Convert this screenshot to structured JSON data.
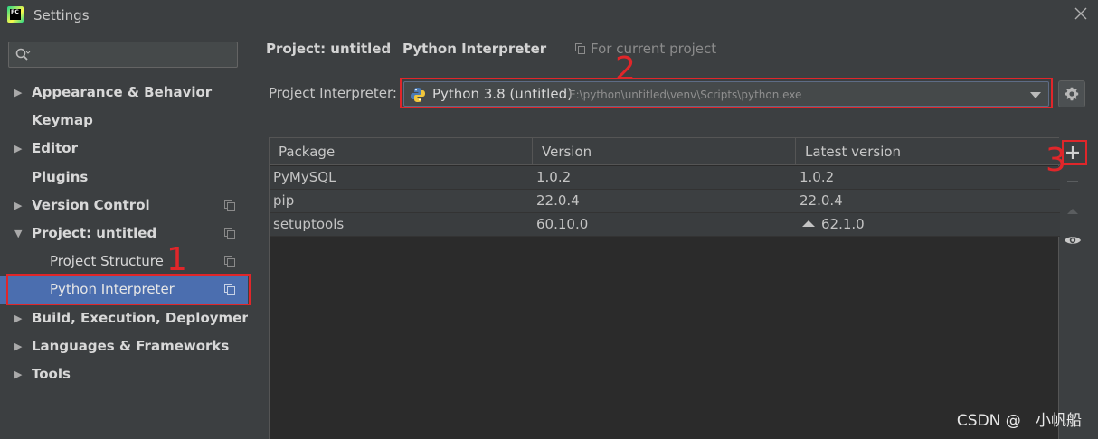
{
  "window": {
    "logo_text": "PC",
    "title": "Settings"
  },
  "sidebar": {
    "search": {
      "value": "",
      "placeholder": ""
    },
    "items": [
      {
        "label": "Appearance & Behavior"
      },
      {
        "label": "Keymap"
      },
      {
        "label": "Editor"
      },
      {
        "label": "Plugins"
      },
      {
        "label": "Version Control"
      },
      {
        "label": "Project: untitled"
      },
      {
        "label": "Project Structure"
      },
      {
        "label": "Python Interpreter"
      },
      {
        "label": "Build, Execution, Deployment"
      },
      {
        "label": "Languages & Frameworks"
      },
      {
        "label": "Tools"
      }
    ]
  },
  "breadcrumb": {
    "project": "Project: untitled",
    "separator": "›",
    "page": "Python Interpreter",
    "hint": "For current project"
  },
  "interpreter": {
    "label": "Project Interpreter:",
    "name": "Python 3.8 (untitled)",
    "path": "E:\\python\\untitled\\venv\\Scripts\\python.exe"
  },
  "packages": {
    "columns": [
      "Package",
      "Version",
      "Latest version"
    ],
    "rows": [
      {
        "name": "PyMySQL",
        "version": "1.0.2",
        "latest": "1.0.2",
        "upgrade": false
      },
      {
        "name": "pip",
        "version": "22.0.4",
        "latest": "22.0.4",
        "upgrade": false
      },
      {
        "name": "setuptools",
        "version": "60.10.0",
        "latest": "62.1.0",
        "upgrade": true
      }
    ]
  },
  "annotations": {
    "one": "1",
    "two": "2",
    "three": "3"
  },
  "watermark": "CSDN @   小帆船",
  "colors": {
    "background": "#3c3f41",
    "selection": "#4b6eaf",
    "annotation_red": "#e0262a",
    "table_bg": "#2b2b2b"
  },
  "icons": {
    "close": "close-icon",
    "search": "search-icon",
    "copy": "copy-icon",
    "python": "python-icon",
    "gear": "gear-icon",
    "add": "plus-icon",
    "remove": "minus-icon",
    "upgrade": "up-triangle-icon",
    "show": "eye-icon"
  }
}
